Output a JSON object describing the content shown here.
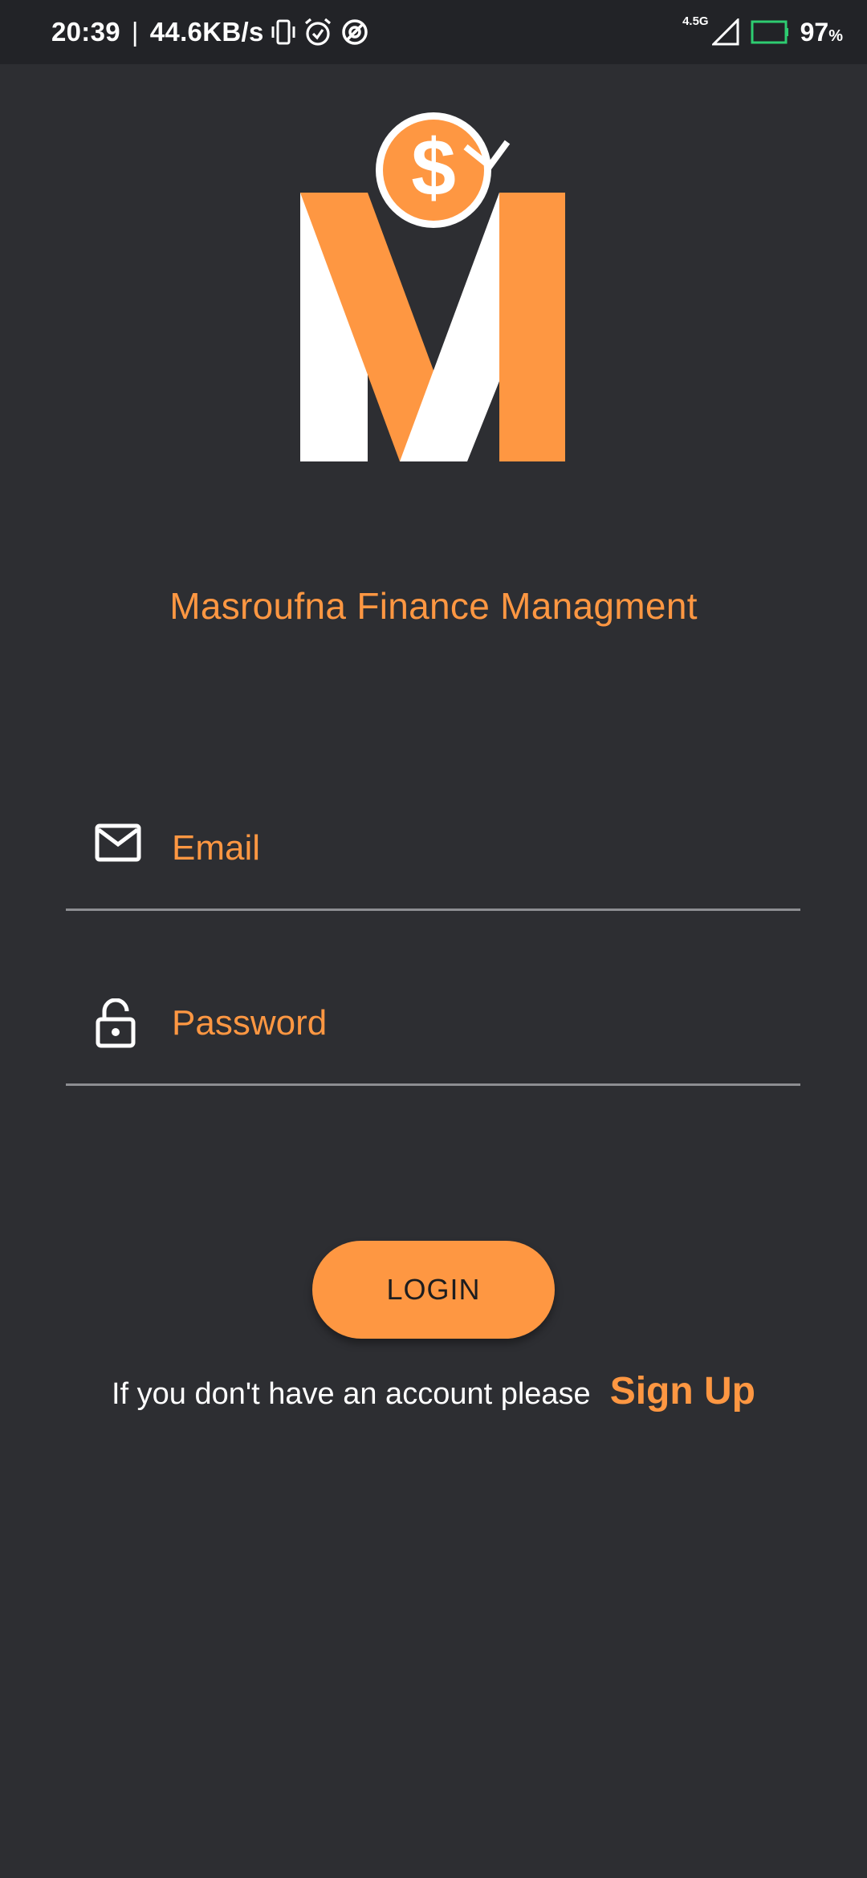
{
  "status_bar": {
    "time": "20:39",
    "separator": "|",
    "net_speed": "44.6KB/s",
    "network_type": "4.5G",
    "battery_percent": "97",
    "battery_unit": "%",
    "icons": [
      "vibrate-icon",
      "alarm-icon",
      "data-saver-icon",
      "signal-icon",
      "battery-icon"
    ]
  },
  "app": {
    "title": "Masroufna Finance Managment",
    "logo_icon": "dollar-coin-m-logo"
  },
  "form": {
    "email_placeholder": "Email",
    "password_placeholder": "Password",
    "email_icon": "mail-icon",
    "password_icon": "lock-open-icon",
    "login_label": "LOGIN"
  },
  "signup": {
    "prompt": "If you don't have an account please",
    "link_label": "Sign Up"
  },
  "colors": {
    "background": "#2d2e32",
    "status_bar": "#222327",
    "accent": "#fe9742",
    "battery_outline": "#2ecc71"
  }
}
